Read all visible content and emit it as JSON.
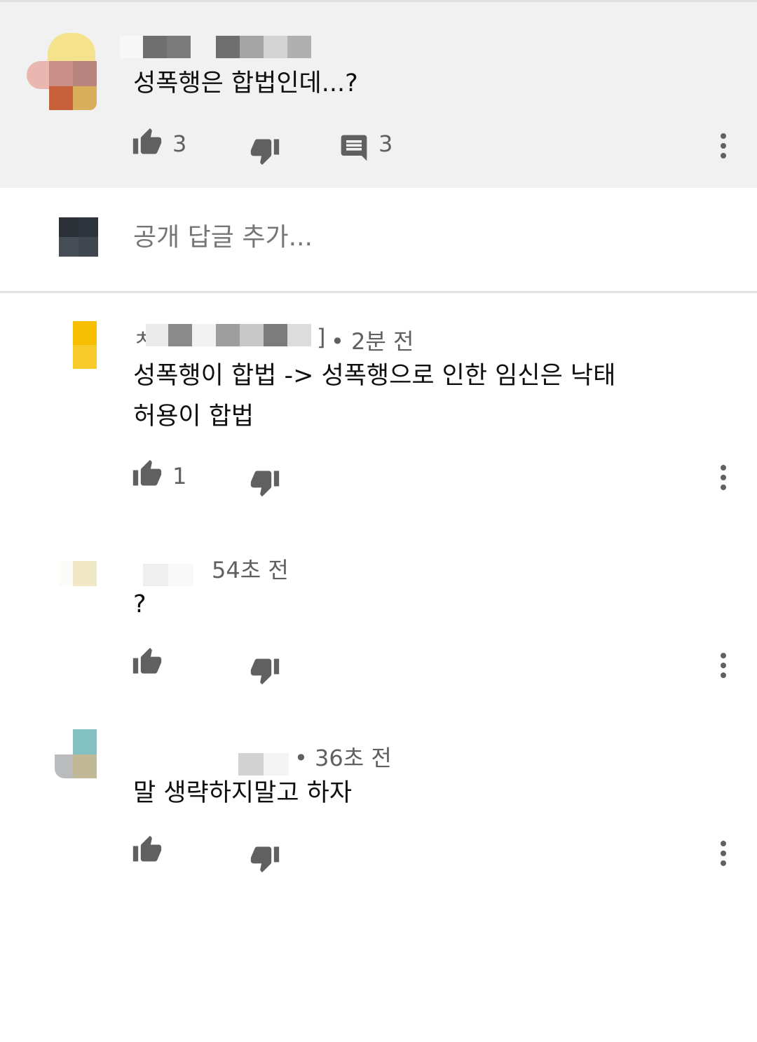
{
  "parent_comment": {
    "text": "성폭행은 합법인데...?",
    "likes": "3",
    "replies_count": "3"
  },
  "reply_box": {
    "placeholder": "공개 답글 추가..."
  },
  "replies": [
    {
      "author_fragment": "ㅊ",
      "author_suffix": "]",
      "time": "• 2분 전",
      "text_line1": "성폭행이 합법 -> 성폭행으로 인한 임신은 낙태",
      "text_line2": "허용이 합법",
      "likes": "1"
    },
    {
      "time": "54초 전",
      "text": "?",
      "likes": ""
    },
    {
      "time": "• 36초 전",
      "text": "말 생략하지말고 하자",
      "likes": ""
    }
  ],
  "icons": {
    "like": "thumbs-up-icon",
    "dislike": "thumbs-down-icon",
    "reply": "comment-icon",
    "more": "more-vertical-icon"
  },
  "colors": {
    "parent_background": "#f1f1f1",
    "secondary_text": "#606060",
    "icon": "#606060"
  }
}
